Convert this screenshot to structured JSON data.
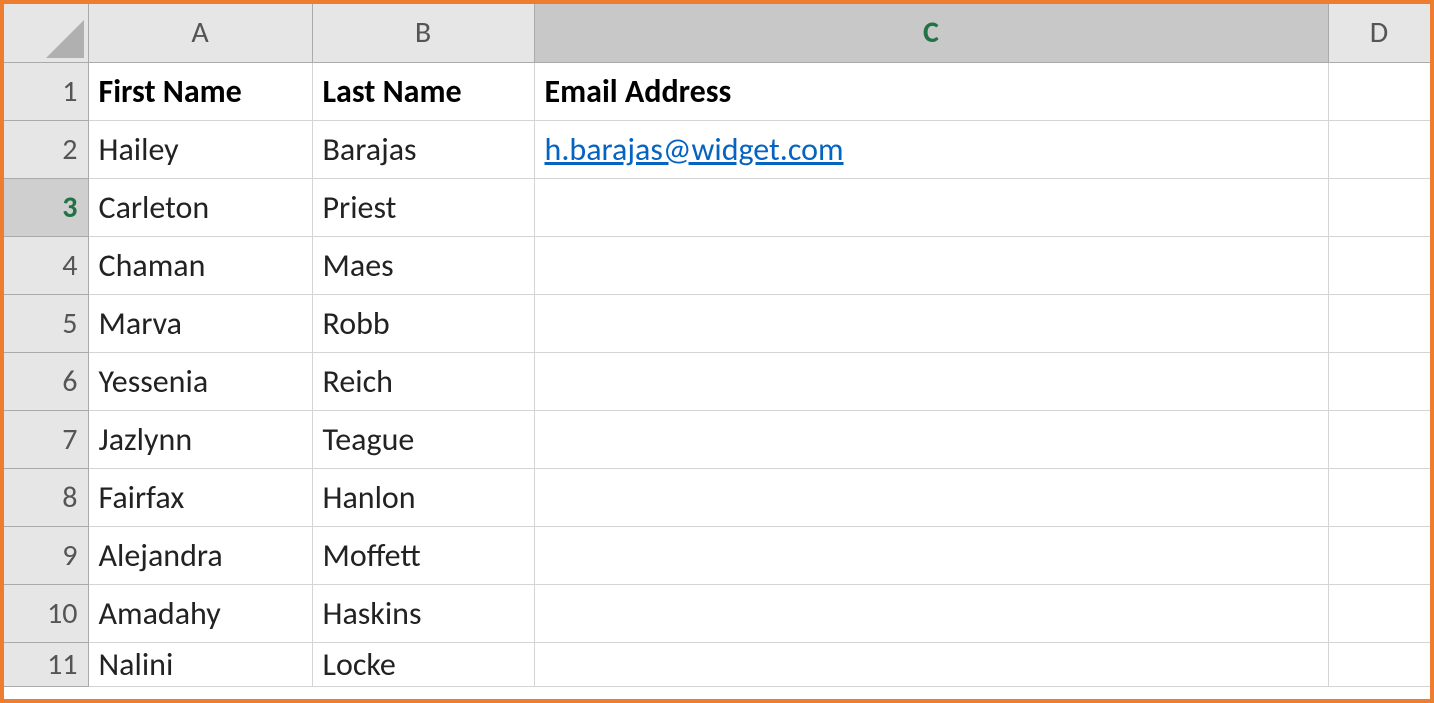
{
  "columns": {
    "A": "A",
    "B": "B",
    "C": "C",
    "D": "D"
  },
  "row_labels": [
    "1",
    "2",
    "3",
    "4",
    "5",
    "6",
    "7",
    "8",
    "9",
    "10",
    "11"
  ],
  "headers": {
    "A": "First Name",
    "B": "Last Name",
    "C": "Email Address"
  },
  "rows": [
    {
      "first": "Hailey",
      "last": "Barajas",
      "email": "h.barajas@widget.com"
    },
    {
      "first": "Carleton",
      "last": "Priest",
      "email": ""
    },
    {
      "first": "Chaman",
      "last": "Maes",
      "email": ""
    },
    {
      "first": "Marva",
      "last": "Robb",
      "email": ""
    },
    {
      "first": "Yessenia",
      "last": "Reich",
      "email": ""
    },
    {
      "first": "Jazlynn",
      "last": "Teague",
      "email": ""
    },
    {
      "first": "Fairfax",
      "last": "Hanlon",
      "email": ""
    },
    {
      "first": "Alejandra",
      "last": "Moffett",
      "email": ""
    },
    {
      "first": "Amadahy",
      "last": "Haskins",
      "email": ""
    },
    {
      "first": "Nalini",
      "last": "Locke",
      "email": ""
    }
  ],
  "active_row_index": 2,
  "selected_column": "C",
  "colors": {
    "frame": "#ed7d31",
    "link": "#0563c1",
    "excel_green": "#217346"
  }
}
